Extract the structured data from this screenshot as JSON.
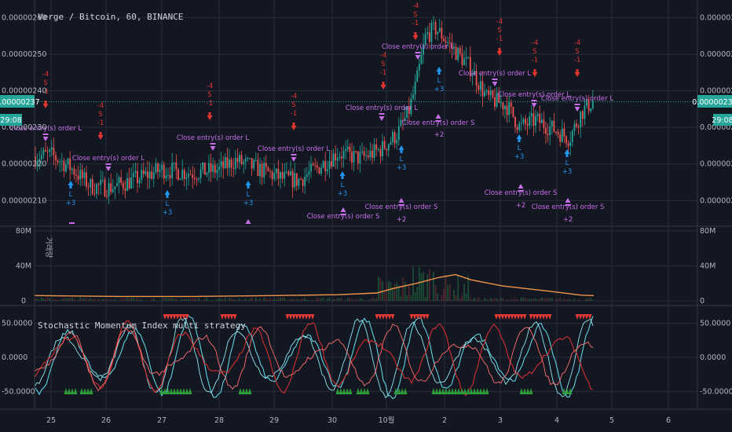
{
  "colors": {
    "background": "#131722",
    "grid": "#2a2e39",
    "up": "#26a69a",
    "down": "#ef5350",
    "short_signal": "#e3342f",
    "long_signal": "#2196f3",
    "close_signal": "#c86ee8",
    "volume_ma": "#f0954a",
    "price_tag": "#26a69a",
    "smi_cyan": "#5fd3e0",
    "smi_red": "#d32f2f",
    "overbought": "#e53935",
    "oversold": "#2e9d3a"
  },
  "header": {
    "title": "Verge / Bitcoin, 60, BINANCE"
  },
  "price_tag": {
    "left_value": "0.00000237",
    "left_timer": "29:08",
    "right_value": "0.00000237",
    "right_timer": "29:08"
  },
  "volume_label": "거래량",
  "indicator_title": "Stochastic Momentum Index multi strategy",
  "x_ticks": [
    "25",
    "26",
    "27",
    "28",
    "29",
    "30",
    "10월",
    "2",
    "3",
    "4",
    "5",
    "6"
  ],
  "chart_data": [
    {
      "type": "candlestick",
      "y_ticks": [
        "0.00000260",
        "0.00000250",
        "0.00000240",
        "0.00000230",
        "0.00000220",
        "0.00000210"
      ],
      "ylim": [
        2.032e-06,
        2.648e-06
      ],
      "x": [
        "25",
        "26",
        "27",
        "28",
        "29",
        "30",
        "10월",
        "2",
        "3",
        "4"
      ],
      "close_approx": [
        2.22e-06,
        2.14e-06,
        2.17e-06,
        2.18e-06,
        2.16e-06,
        2.22e-06,
        2.27e-06,
        2.53e-06,
        2.34e-06,
        2.3e-06
      ],
      "last": 2.37e-06,
      "annotations": [
        {
          "type": "short",
          "lines": [
            "-4",
            "S",
            "-1"
          ]
        },
        {
          "type": "long",
          "lines": [
            "L",
            "+3"
          ]
        },
        {
          "type": "close",
          "text": "Close entry(s) order L"
        },
        {
          "type": "close",
          "text": "Close entry(s) order S"
        },
        {
          "type": "short",
          "lines": [
            "-4",
            "S"
          ]
        },
        {
          "type": "long",
          "lines": [
            "L",
            "+3"
          ]
        },
        {
          "type": "long",
          "lines": [
            "+2"
          ]
        }
      ]
    },
    {
      "type": "bar",
      "y_ticks": [
        "80M",
        "40M",
        "0"
      ],
      "ylim": [
        0,
        80000000
      ],
      "series": [
        {
          "name": "",
          "values": "volume"
        }
      ],
      "moving_average": [
        6000000,
        5000000,
        5000000,
        6000000,
        7000000,
        8000000,
        15000000,
        30000000,
        15000000,
        6000000
      ]
    },
    {
      "type": "line",
      "y_ticks": [
        "50.0000",
        "0.0000",
        "-50.0000"
      ],
      "ylim": [
        -75,
        75
      ],
      "title": "Stochastic Momentum Index multi strategy"
    }
  ]
}
